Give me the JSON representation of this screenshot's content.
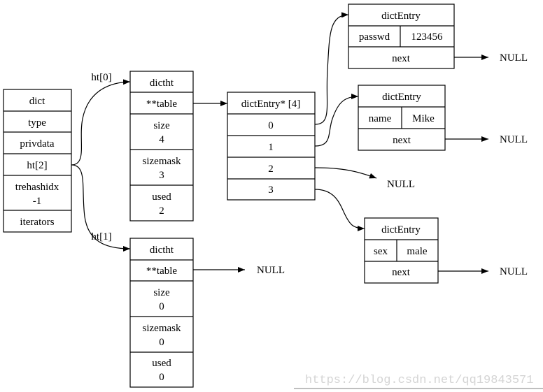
{
  "dict": {
    "title": "dict",
    "fields": [
      "type",
      "privdata",
      "ht[2]"
    ],
    "rehash_label": "trehashidx",
    "rehash_value": "-1",
    "last": "iterators"
  },
  "edges": {
    "ht0": "ht[0]",
    "ht1": "ht[1]"
  },
  "ht0": {
    "title": "dictht",
    "table": "**table",
    "size_label": "size",
    "size": "4",
    "sizemask_label": "sizemask",
    "sizemask": "3",
    "used_label": "used",
    "used": "2"
  },
  "ht1": {
    "title": "dictht",
    "table": "**table",
    "size_label": "size",
    "size": "0",
    "sizemask_label": "sizemask",
    "sizemask": "0",
    "used_label": "used",
    "used": "0"
  },
  "table": {
    "title": "dictEntry* [4]",
    "slots": [
      "0",
      "1",
      "2",
      "3"
    ]
  },
  "entries": [
    {
      "title": "dictEntry",
      "key": "passwd",
      "value": "123456",
      "next": "next"
    },
    {
      "title": "dictEntry",
      "key": "name",
      "value": "Mike",
      "next": "next"
    },
    {
      "title": "dictEntry",
      "key": "sex",
      "value": "male",
      "next": "next"
    }
  ],
  "null_label": "NULL",
  "watermark": "https://blog.csdn.net/qq19843571"
}
